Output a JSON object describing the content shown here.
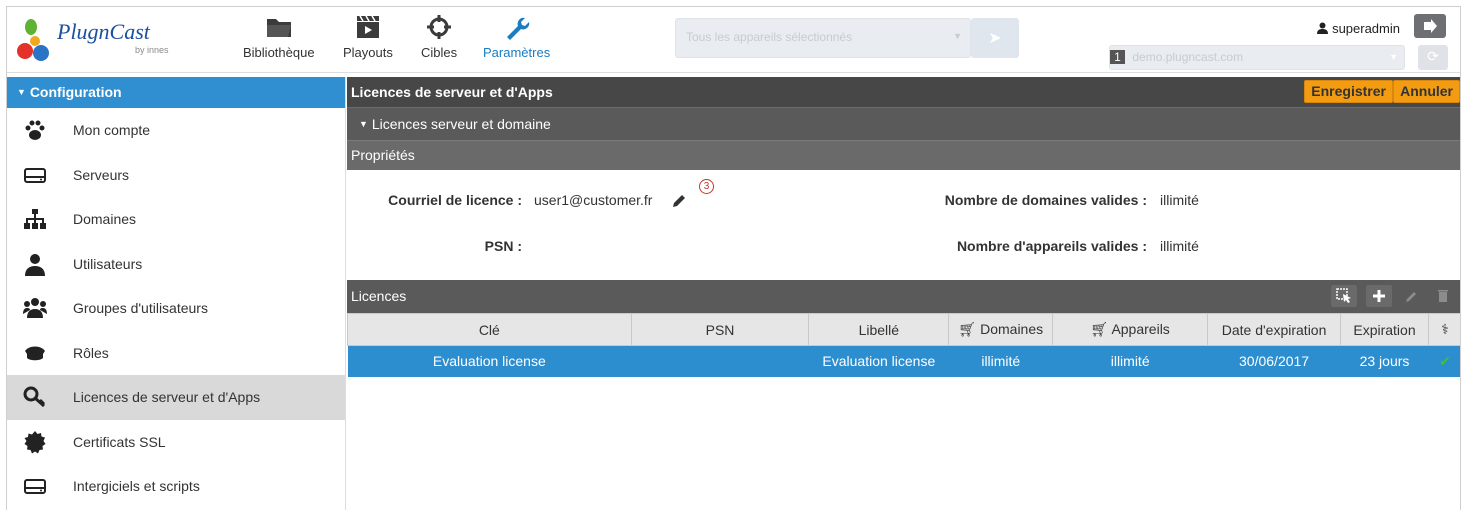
{
  "header": {
    "logo_text": "PlugnCast",
    "logo_sub": "by innes",
    "nav": [
      {
        "label": "Bibliothèque",
        "icon": "folder-icon"
      },
      {
        "label": "Playouts",
        "icon": "clapperboard-icon"
      },
      {
        "label": "Cibles",
        "icon": "target-icon"
      },
      {
        "label": "Paramètres",
        "icon": "wrench-icon",
        "active": true
      }
    ],
    "device_select": "Tous les appareils sélectionnés",
    "domain_index": "1",
    "domain_select": "demo.plugncast.com",
    "user": "superadmin"
  },
  "sidebar": {
    "section": "Configuration",
    "items": [
      {
        "label": "Mon compte",
        "icon": "paw-icon"
      },
      {
        "label": "Serveurs",
        "icon": "server-icon"
      },
      {
        "label": "Domaines",
        "icon": "sitemap-icon"
      },
      {
        "label": "Utilisateurs",
        "icon": "user-icon"
      },
      {
        "label": "Groupes d'utilisateurs",
        "icon": "users-group-icon"
      },
      {
        "label": "Rôles",
        "icon": "police-cap-icon"
      },
      {
        "label": "Licences de serveur et d'Apps",
        "icon": "key-icon",
        "active": true
      },
      {
        "label": "Certificats SSL",
        "icon": "certificate-icon"
      },
      {
        "label": "Intergiciels et scripts",
        "icon": "drive-icon"
      }
    ]
  },
  "main": {
    "title": "Licences de serveur et d'Apps",
    "save_label": "Enregistrer",
    "cancel_label": "Annuler",
    "subsection": "Licences serveur et domaine",
    "properties_title": "Propriétés",
    "props": {
      "email_label": "Courriel de licence :",
      "email_value": "user1@customer.fr",
      "psn_label": "PSN :",
      "psn_value": "",
      "domains_label": "Nombre de domaines valides :",
      "domains_value": "illimité",
      "devices_label": "Nombre d'appareils valides :",
      "devices_value": "illimité"
    },
    "callout_number": "3",
    "licences_title": "Licences",
    "columns": [
      "Clé",
      "PSN",
      "Libellé",
      "Domaines",
      "Appareils",
      "Date d'expiration",
      "Expiration",
      ""
    ],
    "rows": [
      {
        "key": "Evaluation license",
        "psn": "",
        "label": "Evaluation license",
        "domains": "illimité",
        "devices": "illimité",
        "expiry_date": "30/06/2017",
        "expiration": "23 jours",
        "status": "✔"
      }
    ]
  },
  "colors": {
    "accent_blue": "#2f8fd0",
    "row_blue": "#2d8ecf",
    "orange": "#f39c12",
    "dark_bar": "#474747"
  }
}
